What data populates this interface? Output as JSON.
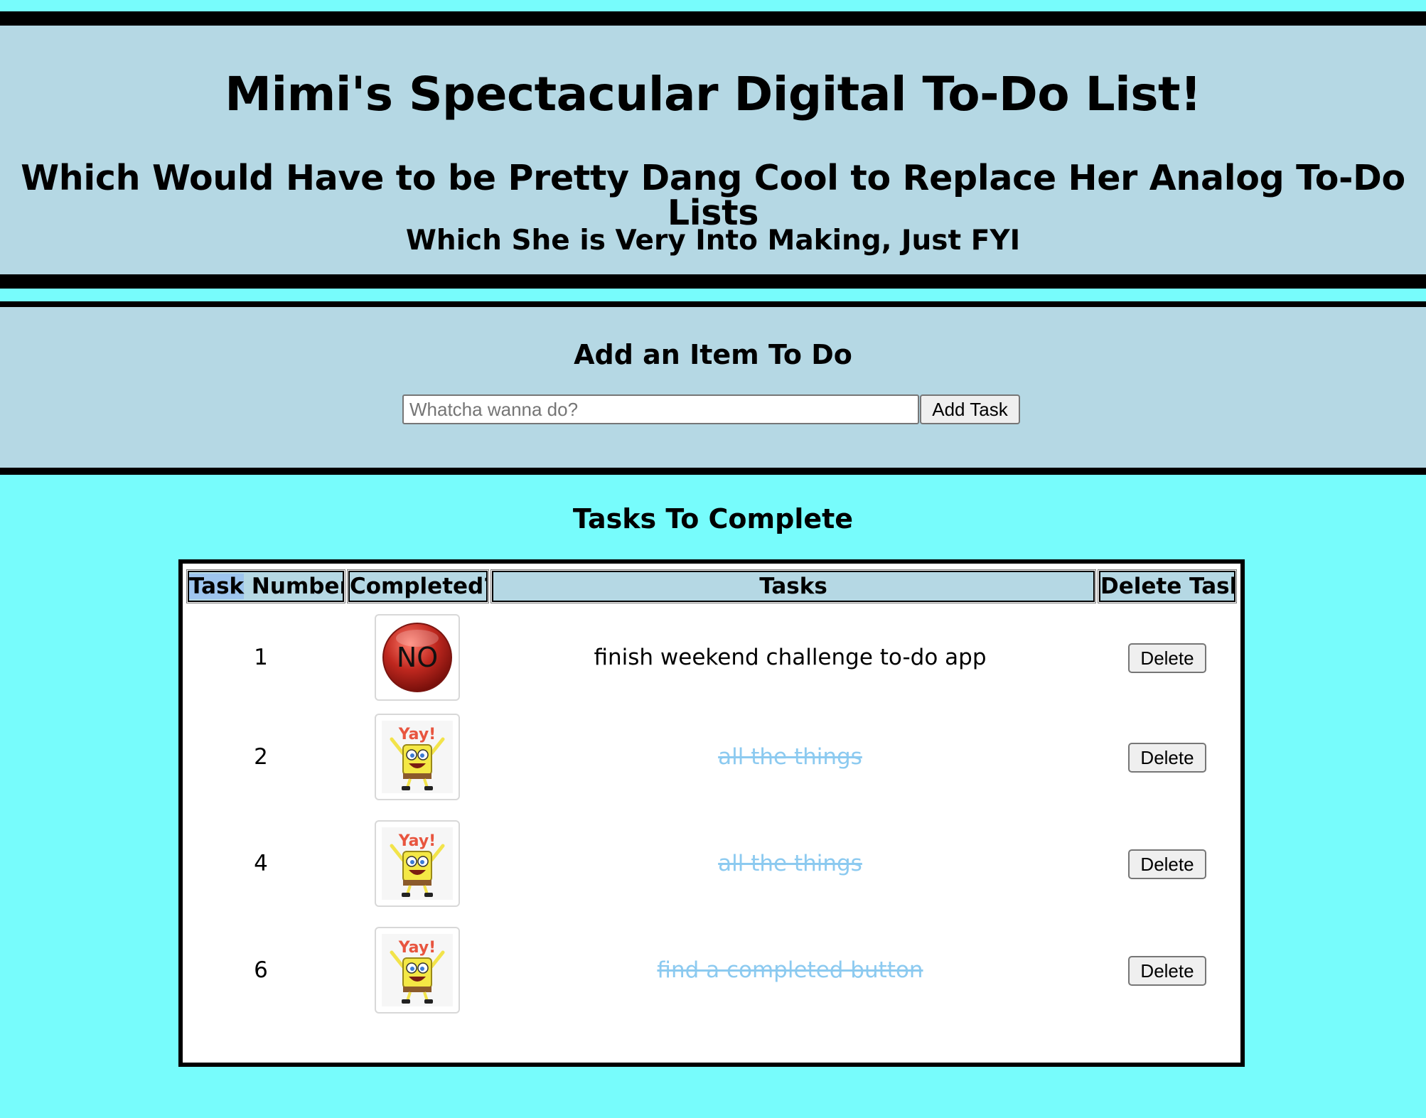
{
  "header": {
    "title": "Mimi's Spectacular Digital To-Do List!",
    "subtitle": "Which Would Have to be Pretty Dang Cool to Replace Her Analog To-Do Lists",
    "tagline": "Which She is Very Into Making, Just FYI"
  },
  "add_section": {
    "heading": "Add an Item To Do",
    "input_placeholder": "Whatcha wanna do?",
    "input_value": "",
    "button_label": "Add Task"
  },
  "tasks_section": {
    "heading": "Tasks To Complete",
    "columns": {
      "number_highlight": "Task",
      "number_rest": " Number",
      "completed": "Completed?",
      "task": "Tasks",
      "delete": "Delete Task"
    },
    "rows": [
      {
        "number": "1",
        "completed": false,
        "badge_text": "NO",
        "task": "finish weekend challenge to-do app",
        "delete_label": "Delete"
      },
      {
        "number": "2",
        "completed": true,
        "badge_text": "Yay!",
        "task": "all the things",
        "delete_label": "Delete"
      },
      {
        "number": "4",
        "completed": true,
        "badge_text": "Yay!",
        "task": "all the things",
        "delete_label": "Delete"
      },
      {
        "number": "6",
        "completed": true,
        "badge_text": "Yay!",
        "task": "find a completed button",
        "delete_label": "Delete"
      }
    ]
  },
  "colors": {
    "page_background": "#77fcfc",
    "panel_background": "#b5d8e4",
    "completed_text": "#8ccaf0",
    "no_badge": "#c0281f",
    "yay_text": "#e8553f"
  }
}
